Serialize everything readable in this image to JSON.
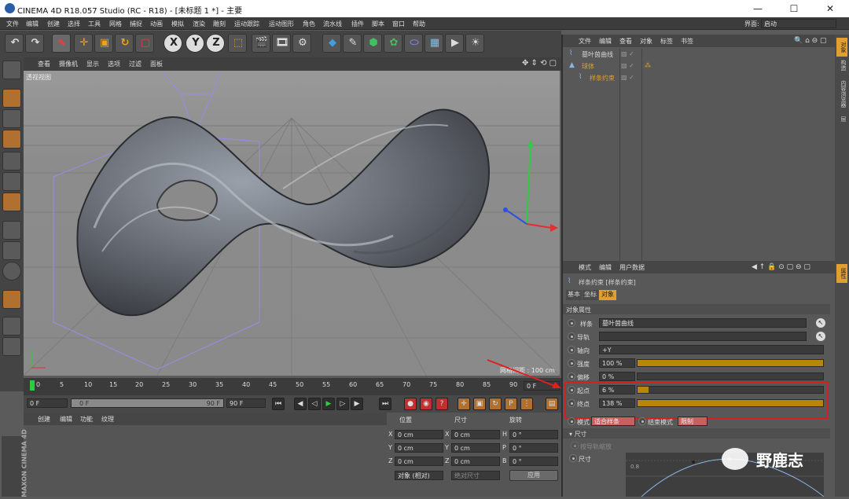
{
  "window": {
    "title": "CINEMA 4D R18.057 Studio (RC - R18) - [未标题 1 *] - 主要",
    "min": "—",
    "max": "☐",
    "close": "✕"
  },
  "menubar": {
    "items": [
      "文件",
      "编辑",
      "创建",
      "选择",
      "工具",
      "网格",
      "捕捉",
      "动画",
      "模拟",
      "渲染",
      "雕刻",
      "运动跟踪",
      "运动图形",
      "角色",
      "流水线",
      "插件",
      "脚本",
      "窗口",
      "帮助"
    ],
    "layout_label": "界面:",
    "layout_value": "启动"
  },
  "toolbar": {
    "x": "X",
    "y": "Y",
    "z": "Z"
  },
  "viewport": {
    "menu": [
      "查看",
      "摄像机",
      "显示",
      "选项",
      "过滤",
      "面板"
    ],
    "label": "透视视图",
    "grid": "网格间距 : 100 cm"
  },
  "timeline": {
    "ticks": [
      "0",
      "5",
      "10",
      "15",
      "20",
      "25",
      "30",
      "35",
      "40",
      "45",
      "50",
      "55",
      "60",
      "65",
      "70",
      "75",
      "80",
      "85",
      "90"
    ],
    "current": "0 F"
  },
  "playbar": {
    "start": "0 F",
    "slider_left": "0 F",
    "slider_right": "90 F",
    "end": "90 F"
  },
  "materials": {
    "menu": [
      "创建",
      "编辑",
      "功能",
      "纹理"
    ]
  },
  "coords": {
    "headers": [
      "位置",
      "尺寸",
      "旋转"
    ],
    "rows": [
      {
        "a": "X",
        "av": "0 cm",
        "b": "X",
        "bv": "0 cm",
        "c": "H",
        "cv": "0 °"
      },
      {
        "a": "Y",
        "av": "0 cm",
        "b": "Y",
        "bv": "0 cm",
        "c": "P",
        "cv": "0 °"
      },
      {
        "a": "Z",
        "av": "0 cm",
        "b": "Z",
        "bv": "0 cm",
        "c": "B",
        "cv": "0 °"
      }
    ],
    "mode": "对象 (相对)",
    "size_mode": "绝对尺寸",
    "apply": "应用"
  },
  "objects": {
    "menu": [
      "文件",
      "编辑",
      "查看",
      "对象",
      "标签",
      "书签"
    ],
    "items": [
      {
        "name": "墓叶茵曲线",
        "color": "#d2d2d2",
        "indent": 0
      },
      {
        "name": "球体",
        "color": "#e0a030",
        "indent": 0
      },
      {
        "name": "样条约束",
        "color": "#e0a030",
        "indent": 12
      }
    ]
  },
  "attributes": {
    "menu": [
      "模式",
      "编辑",
      "用户数据"
    ],
    "title": "样条约束 [样条约束]",
    "tabs": [
      "基本",
      "坐标",
      "对象"
    ],
    "section": "对象属性",
    "spline_label": "样条",
    "spline_value": "墓叶茵曲线",
    "rail_label": "导轨",
    "axis_label": "轴向",
    "axis_value": "+Y",
    "strength_label": "强度",
    "strength_value": "100 %",
    "strength": 1.0,
    "offset_label": "偏移",
    "offset_value": "0 %",
    "offset": 0.0,
    "start_label": "起点",
    "start_value": "6 %",
    "start": 0.06,
    "end_label": "终点",
    "end_value": "138 %",
    "end": 1.0,
    "mode_label": "模式",
    "mode_value": "适合样条",
    "end_mode_label": "结束模式",
    "end_mode_value": "限制",
    "size_section": "尺寸",
    "along_rail": "按导轨缩放",
    "size_label": "尺寸",
    "graph_tick": "0.8"
  },
  "rightstrip": {
    "tabs": [
      "对象",
      "构造",
      "内容浏览器",
      "层"
    ],
    "attr_tab": "属性"
  },
  "watermark": "野鹿志",
  "brand": "MAXON CINEMA 4D",
  "colors": {
    "accent": "#e0a030",
    "highlight": "#d02020",
    "timeline_marker": "#2ecc40"
  }
}
